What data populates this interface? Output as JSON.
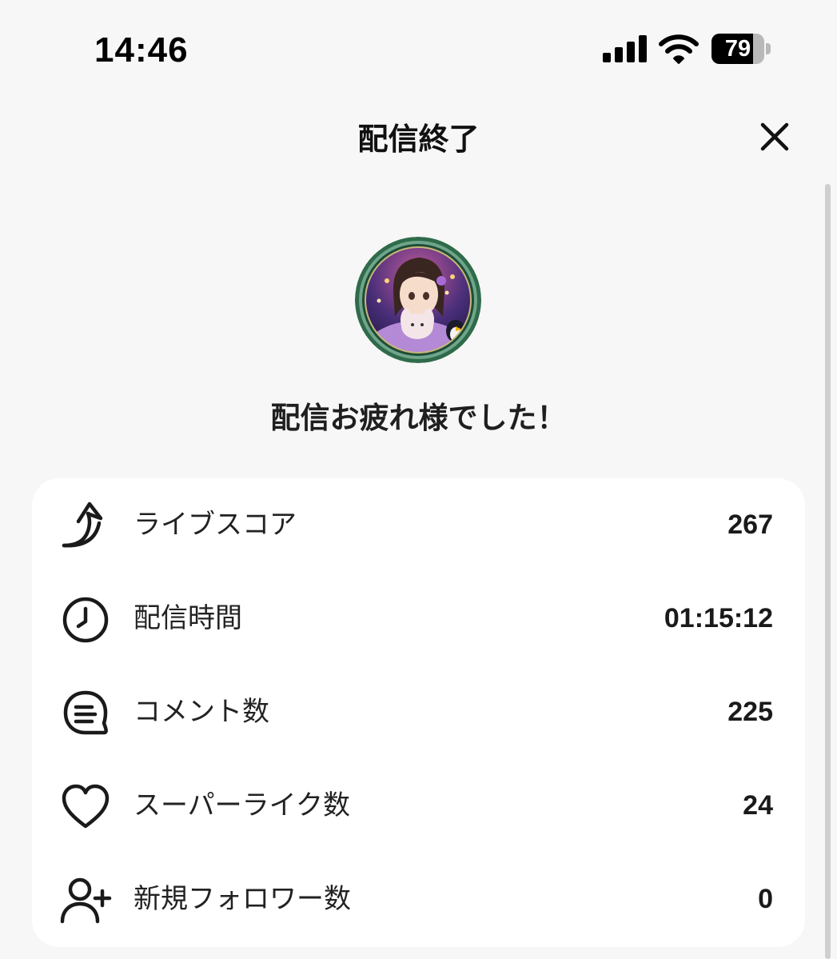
{
  "status_bar": {
    "time": "14:46",
    "battery_level": "79",
    "battery_fraction": 0.79
  },
  "header": {
    "title": "配信終了",
    "close_icon": "close-icon"
  },
  "message": "配信お疲れ様でした！",
  "stats": [
    {
      "icon": "trending-up-arrow-icon",
      "label": "ライブスコア",
      "value": "267"
    },
    {
      "icon": "clock-icon",
      "label": "配信時間",
      "value": "01:15:12"
    },
    {
      "icon": "comment-bubble-icon",
      "label": "コメント数",
      "value": "225"
    },
    {
      "icon": "heart-icon",
      "label": "スーパーライク数",
      "value": "24"
    },
    {
      "icon": "add-person-icon",
      "label": "新規フォロワー数",
      "value": "0"
    }
  ],
  "colors": {
    "background": "#f7f7f7",
    "card": "#ffffff",
    "text": "#1a1a1a",
    "avatar_ring": "#2f6b4a"
  }
}
